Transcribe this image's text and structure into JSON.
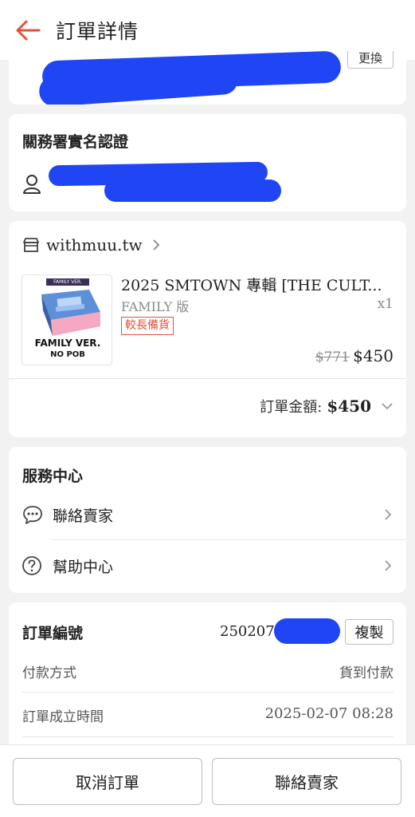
{
  "header": {
    "title": "訂單詳情"
  },
  "top_card": {
    "button_label": "更換"
  },
  "customs": {
    "title": "關務署實名認證"
  },
  "shop": {
    "name": "withmuu.tw",
    "product": {
      "title": "2025 SMTOWN 專輯 [THE CULT...",
      "variant": "FAMILY 版",
      "quantity": "x1",
      "tag": "較長備貨",
      "original_price": "$771",
      "price": "$450",
      "image_top_label": "FAMILY VER.",
      "image_label_line1": "FAMILY VER.",
      "image_label_line2": "NO POB"
    },
    "order_total_label": "訂單金額:",
    "order_total_value": "$450"
  },
  "service": {
    "title": "服務中心",
    "contact_seller": "聯絡賣家",
    "help_center": "幫助中心"
  },
  "order_info": {
    "order_no_label": "訂單編號",
    "order_no_value": "250207",
    "copy_label": "複製",
    "payment_label": "付款方式",
    "payment_value": "貨到付款",
    "created_label": "訂單成立時間",
    "created_value": "2025-02-07 08:28"
  },
  "bottom": {
    "cancel_label": "取消訂單",
    "contact_label": "聯絡賣家"
  },
  "colors": {
    "accent": "#e2533a",
    "redaction": "#1f45f5"
  }
}
